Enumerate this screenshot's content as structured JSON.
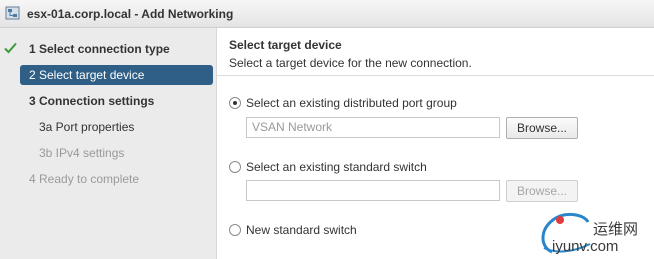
{
  "window": {
    "title": "esx-01a.corp.local - Add Networking",
    "icon": "network-wizard-icon"
  },
  "sidebar": {
    "steps": [
      {
        "label": "1  Select connection type",
        "state": "completed"
      },
      {
        "label": "2  Select target device",
        "state": "active"
      },
      {
        "label": "3  Connection settings",
        "state": "pending"
      },
      {
        "label": "3a  Port properties",
        "state": "pending"
      },
      {
        "label": "3b  IPv4 settings",
        "state": "disabled"
      },
      {
        "label": "4  Ready to complete",
        "state": "disabled"
      }
    ]
  },
  "main": {
    "heading": "Select target device",
    "subheading": "Select a target device for the new connection.",
    "options": [
      {
        "label": "Select an existing distributed port group",
        "selected": true
      },
      {
        "label": "Select an existing standard switch",
        "selected": false
      },
      {
        "label": "New standard switch",
        "selected": false
      }
    ],
    "distributed_input": {
      "value": "VSAN Network"
    },
    "standard_input": {
      "value": ""
    },
    "browse_label": "Browse..."
  },
  "watermark": {
    "text": "运维网",
    "url": "iyunv.com"
  },
  "colors": {
    "active_step": "#2f5f86",
    "check": "#3a9a3a",
    "sidebar_bg": "#ebebeb"
  }
}
